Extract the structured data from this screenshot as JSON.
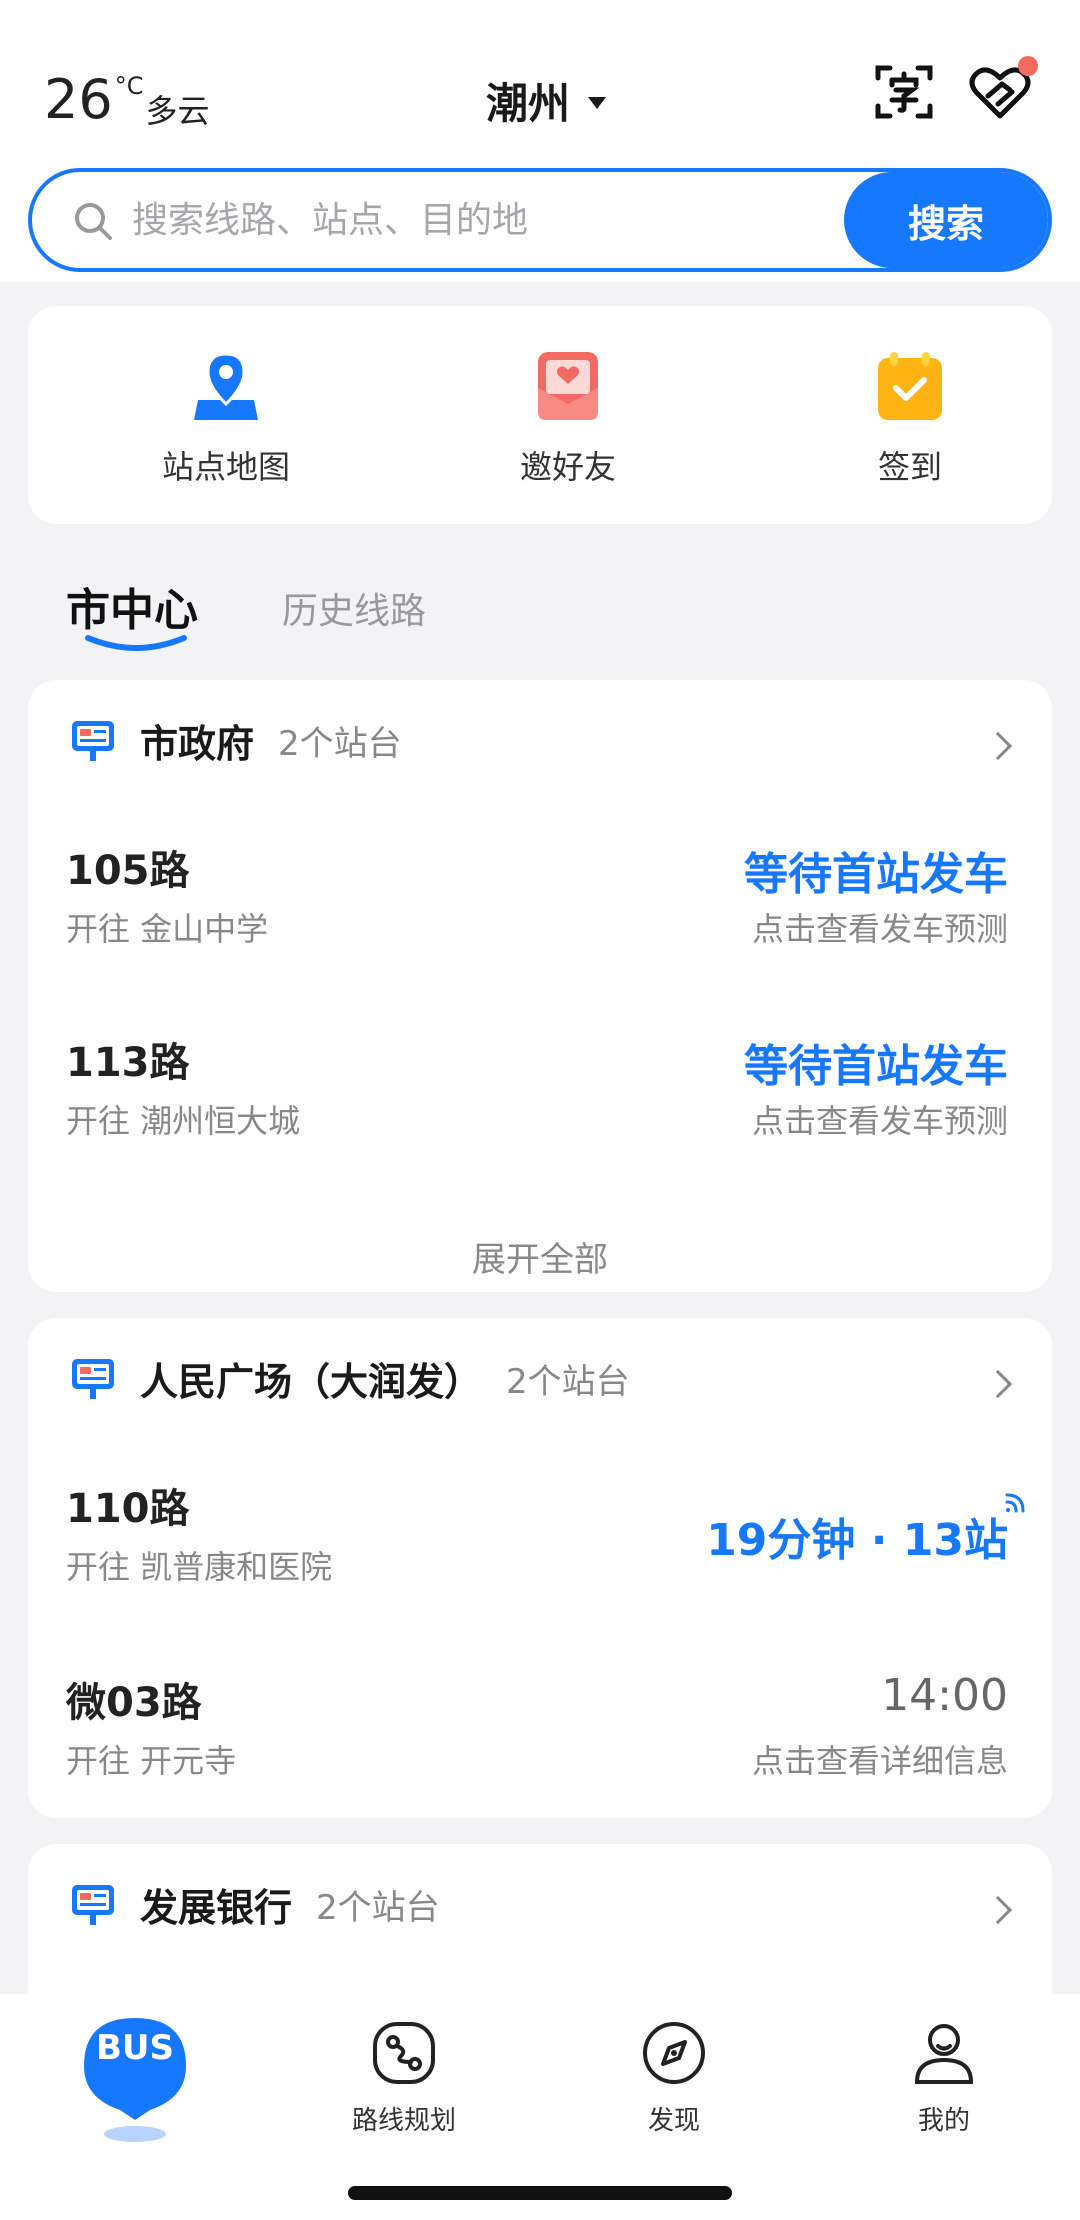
{
  "header": {
    "temperature": "26",
    "unit": "°C",
    "condition": "多云",
    "city": "潮州",
    "scan_icon": "text-scan-icon",
    "care_icon": "care-heart-icon",
    "notification_color": "#f56a5f"
  },
  "search": {
    "placeholder": "搜索线路、站点、目的地",
    "value": "",
    "button_label": "搜索"
  },
  "quick_actions": [
    {
      "label": "站点地图",
      "icon": "map-pin-icon"
    },
    {
      "label": "邀好友",
      "icon": "invite-envelope-icon"
    },
    {
      "label": "签到",
      "icon": "checkin-calendar-icon"
    }
  ],
  "tabs": [
    {
      "label": "市中心",
      "active": true
    },
    {
      "label": "历史线路",
      "active": false
    }
  ],
  "stations": [
    {
      "name": "市政府",
      "count": "2个站台",
      "routes": [
        {
          "route": "105路",
          "dest": "开往 金山中学",
          "status": "等待首站发车",
          "sub": "点击查看发车预测"
        },
        {
          "route": "113路",
          "dest": "开往 潮州恒大城",
          "status": "等待首站发车",
          "sub": "点击查看发车预测"
        }
      ],
      "expand": "展开全部"
    },
    {
      "name": "人民广场（大润发）",
      "count": "2个站台",
      "routes": [
        {
          "route": "110路",
          "dest": "开往 凯普康和医院",
          "status": "19分钟 · 13站",
          "sub": ""
        },
        {
          "route": "微03路",
          "dest": "开往 开元寺",
          "status": "14:00",
          "sub": "点击查看详细信息"
        }
      ]
    },
    {
      "name": "发展银行",
      "count": "2个站台",
      "routes": []
    }
  ],
  "nav": {
    "bus": "BUS",
    "items": [
      {
        "label": "路线规划",
        "icon": "route-plan-icon"
      },
      {
        "label": "发现",
        "icon": "compass-icon"
      },
      {
        "label": "我的",
        "icon": "user-icon"
      }
    ]
  },
  "colors": {
    "accent": "#1677ff",
    "background": "#f3f3f6",
    "muted_text": "#888888"
  }
}
